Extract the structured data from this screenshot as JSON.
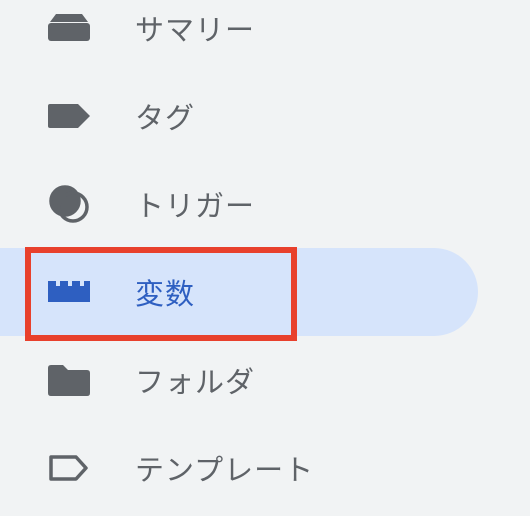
{
  "sidebar": {
    "items": [
      {
        "label": "サマリー",
        "icon": "summary-icon"
      },
      {
        "label": "タグ",
        "icon": "tag-icon"
      },
      {
        "label": "トリガー",
        "icon": "trigger-icon"
      },
      {
        "label": "変数",
        "icon": "variable-icon",
        "active": true
      },
      {
        "label": "フォルダ",
        "icon": "folder-icon"
      },
      {
        "label": "テンプレート",
        "icon": "template-icon"
      }
    ]
  },
  "colors": {
    "background": "#f1f3f4",
    "active_background": "#d6e4fb",
    "active_text": "#2e5fc1",
    "icon_gray": "#5f6368",
    "highlight_border": "#e8402c"
  }
}
